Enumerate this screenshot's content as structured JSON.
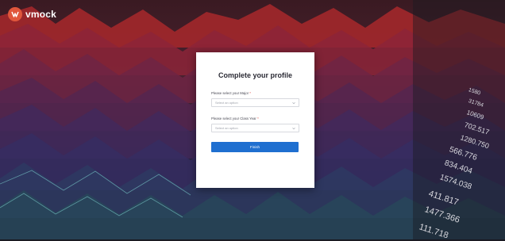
{
  "brand": {
    "name": "vmock"
  },
  "form": {
    "title": "Complete your profile",
    "major": {
      "label": "Please select your Major",
      "required_mark": "*",
      "placeholder": "Select an option"
    },
    "class_year": {
      "label": "Please select your Class Year",
      "required_mark": "*",
      "placeholder": "Select an option"
    },
    "finish_label": "Finish"
  },
  "background_numbers": [
    "1580",
    "31784",
    "10609",
    "702.517",
    "1280.750",
    "566.776",
    "834.404",
    "1574.038",
    "411.817",
    "1477.366",
    "111.718"
  ],
  "colors": {
    "accent": "#1f6fd0",
    "brand": "#e0563c",
    "required": "#e0443c"
  }
}
